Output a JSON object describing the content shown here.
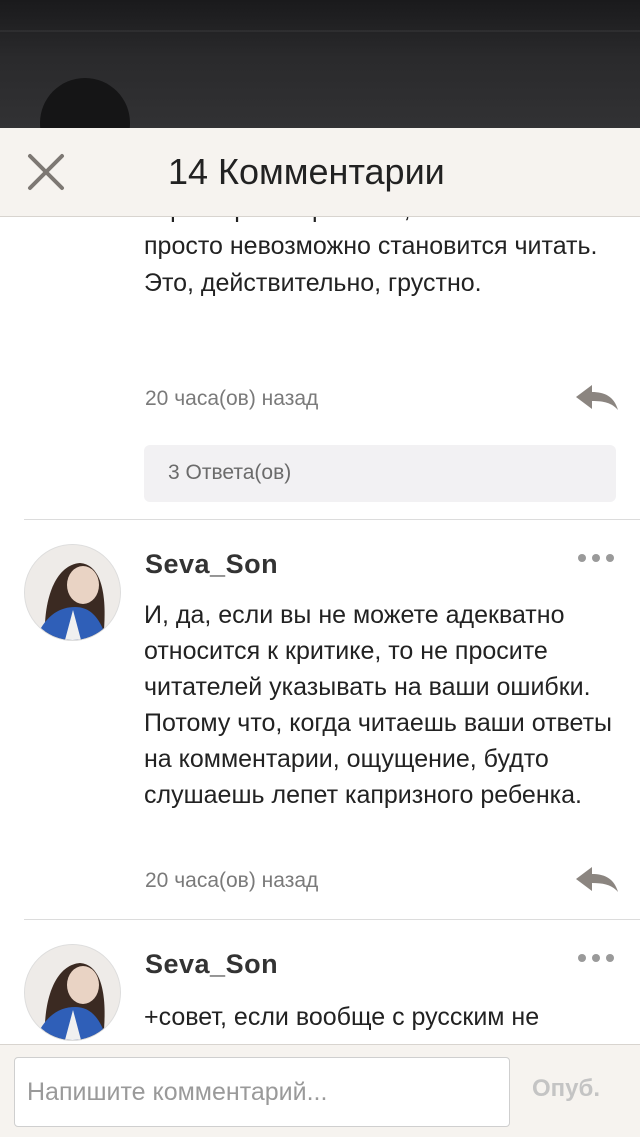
{
  "header": {
    "title": "14 Комментарии"
  },
  "comments": [
    {
      "text_partial": "характеры гг нравятся, но из-за ошибок просто невозможно становится читать. Это, действительно, грустно.",
      "time": "20 часа(ов) назад",
      "replies_label": "3 Ответа(ов)"
    },
    {
      "author": "Seva_Son",
      "text": "И, да, если вы не можете адекватно относится к критике, то не просите читателей указывать на ваши ошибки. Потому что, когда читаешь ваши ответы на комментарии, ощущение, будто слушаешь лепет капризного ребенка.",
      "time": "20 часа(ов) назад"
    },
    {
      "author": "Seva_Son",
      "text": "+совет, если вообще с русским не"
    }
  ],
  "footer": {
    "input_placeholder": "Напишите комментарий...",
    "publish_label": "Опуб."
  },
  "colors": {
    "header_bg": "#f6f3ef",
    "reply_icon": "#8b8580",
    "replies_bg": "#f2f1f3"
  },
  "icons": {
    "close": "close-icon",
    "reply": "reply-arrow-icon",
    "more": "more-dots-icon"
  }
}
